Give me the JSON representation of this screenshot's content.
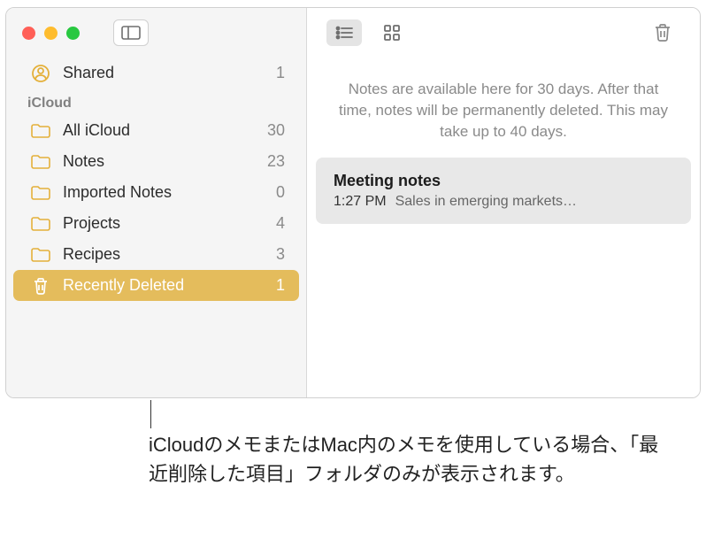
{
  "sidebar": {
    "shared": {
      "label": "Shared",
      "count": "1"
    },
    "section": "iCloud",
    "folders": [
      {
        "label": "All iCloud",
        "count": "30"
      },
      {
        "label": "Notes",
        "count": "23"
      },
      {
        "label": "Imported Notes",
        "count": "0"
      },
      {
        "label": "Projects",
        "count": "4"
      },
      {
        "label": "Recipes",
        "count": "3"
      }
    ],
    "recently_deleted": {
      "label": "Recently Deleted",
      "count": "1"
    }
  },
  "main": {
    "info": "Notes are available here for 30 days. After that time, notes will be permanently deleted. This may take up to 40 days.",
    "note": {
      "title": "Meeting notes",
      "time": "1:27 PM",
      "preview": "Sales in emerging markets…"
    }
  },
  "callout": "iCloudのメモまたはMac内のメモを使用している場合、「最近削除した項目」フォルダのみが表示されます。"
}
